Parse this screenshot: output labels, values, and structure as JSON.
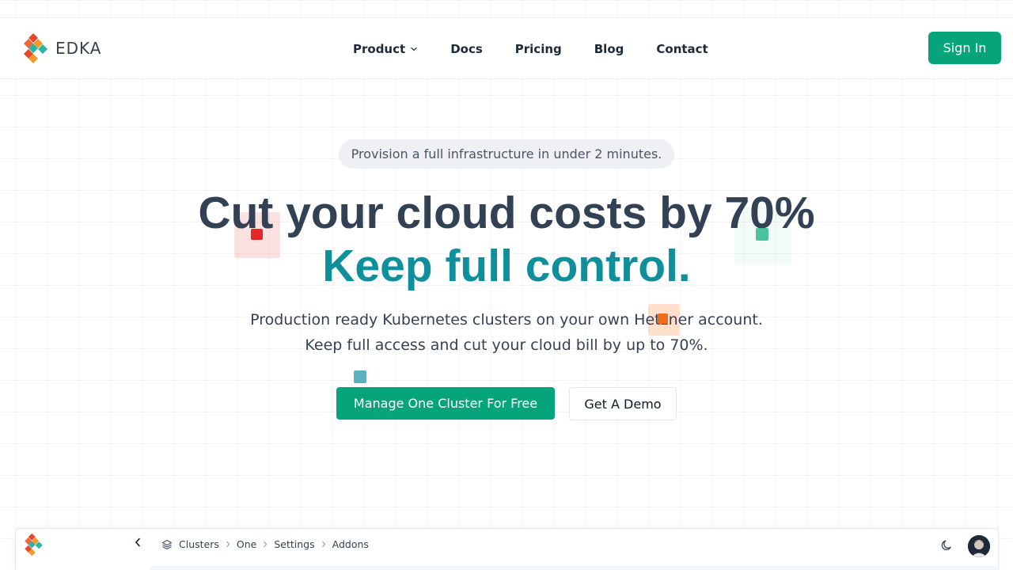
{
  "brand": {
    "name": "EDKA",
    "colors": {
      "accent": "#06a47b",
      "teal": "#0e8f9b",
      "heading": "#334155"
    }
  },
  "nav": {
    "items": [
      {
        "label": "Product",
        "has_dropdown": true
      },
      {
        "label": "Docs"
      },
      {
        "label": "Pricing"
      },
      {
        "label": "Blog"
      },
      {
        "label": "Contact"
      }
    ],
    "signin_label": "Sign In"
  },
  "hero": {
    "pill": "Provision a full infrastructure in under 2 minutes.",
    "headline_line1": "Cut your cloud costs by 70%",
    "headline_line2": "Keep full control.",
    "subtext_line1": "Production ready Kubernetes clusters on your own Hetzner account.",
    "subtext_line2": "Keep full access and cut your cloud bill by up to 70%.",
    "primary_cta": "Manage One Cluster For Free",
    "secondary_cta": "Get A Demo"
  },
  "app_preview": {
    "breadcrumb": [
      "Clusters",
      "One",
      "Settings",
      "Addons"
    ],
    "icons": [
      "layers-icon",
      "chevron-left-icon",
      "moon-icon",
      "avatar"
    ]
  }
}
